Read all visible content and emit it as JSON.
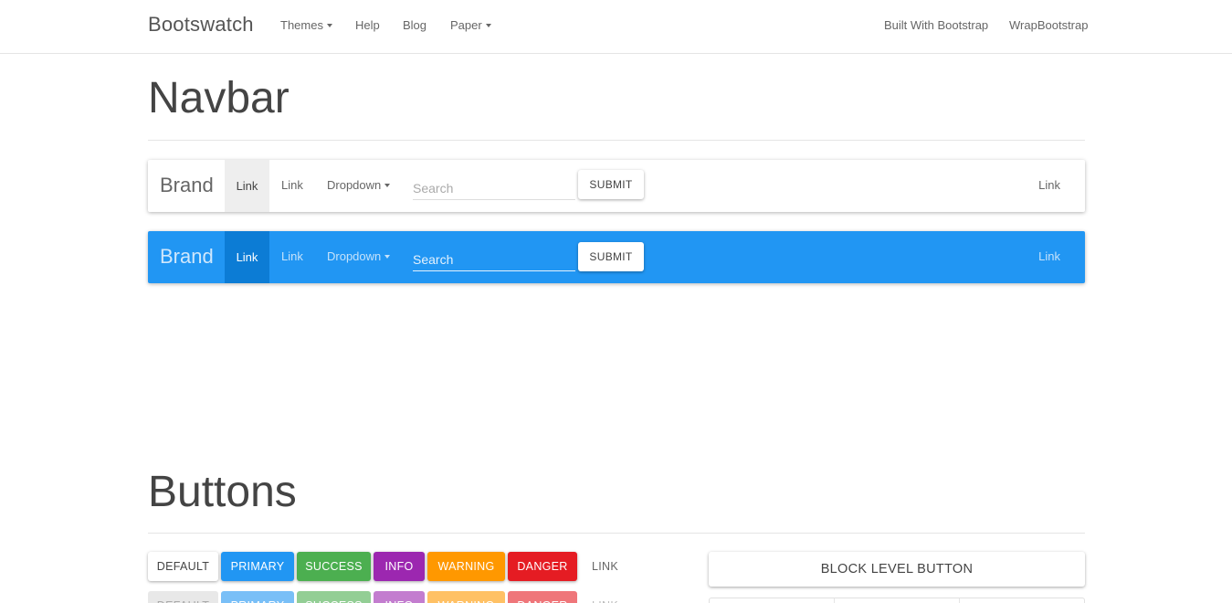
{
  "topnav": {
    "brand": "Bootswatch",
    "items": [
      {
        "label": "Themes",
        "dropdown": true
      },
      {
        "label": "Help",
        "dropdown": false
      },
      {
        "label": "Blog",
        "dropdown": false
      },
      {
        "label": "Paper",
        "dropdown": true
      }
    ],
    "right_items": [
      {
        "label": "Built With Bootstrap"
      },
      {
        "label": "WrapBootstrap"
      }
    ]
  },
  "navbar_section": {
    "title": "Navbar",
    "default_navbar": {
      "brand": "Brand",
      "active_link": "Link",
      "link": "Link",
      "dropdown": "Dropdown",
      "search_placeholder": "Search",
      "submit": "SUBMIT",
      "right_link": "Link"
    },
    "inverse_navbar": {
      "brand": "Brand",
      "active_link": "Link",
      "link": "Link",
      "dropdown": "Dropdown",
      "search_placeholder": "Search",
      "submit": "SUBMIT",
      "right_link": "Link"
    }
  },
  "buttons_section": {
    "title": "Buttons",
    "row1": [
      "DEFAULT",
      "PRIMARY",
      "SUCCESS",
      "INFO",
      "WARNING",
      "DANGER",
      "LINK"
    ],
    "row2": [
      "DEFAULT",
      "PRIMARY",
      "SUCCESS",
      "INFO",
      "WARNING",
      "DANGER",
      "LINK"
    ],
    "block_button": "BLOCK LEVEL BUTTON"
  },
  "colors": {
    "primary": "#2196f3",
    "success": "#4caf50",
    "info": "#9c27b0",
    "warning": "#ff9800",
    "danger": "#e51c23",
    "navbar_inverse_active": "#0c7cd5"
  }
}
